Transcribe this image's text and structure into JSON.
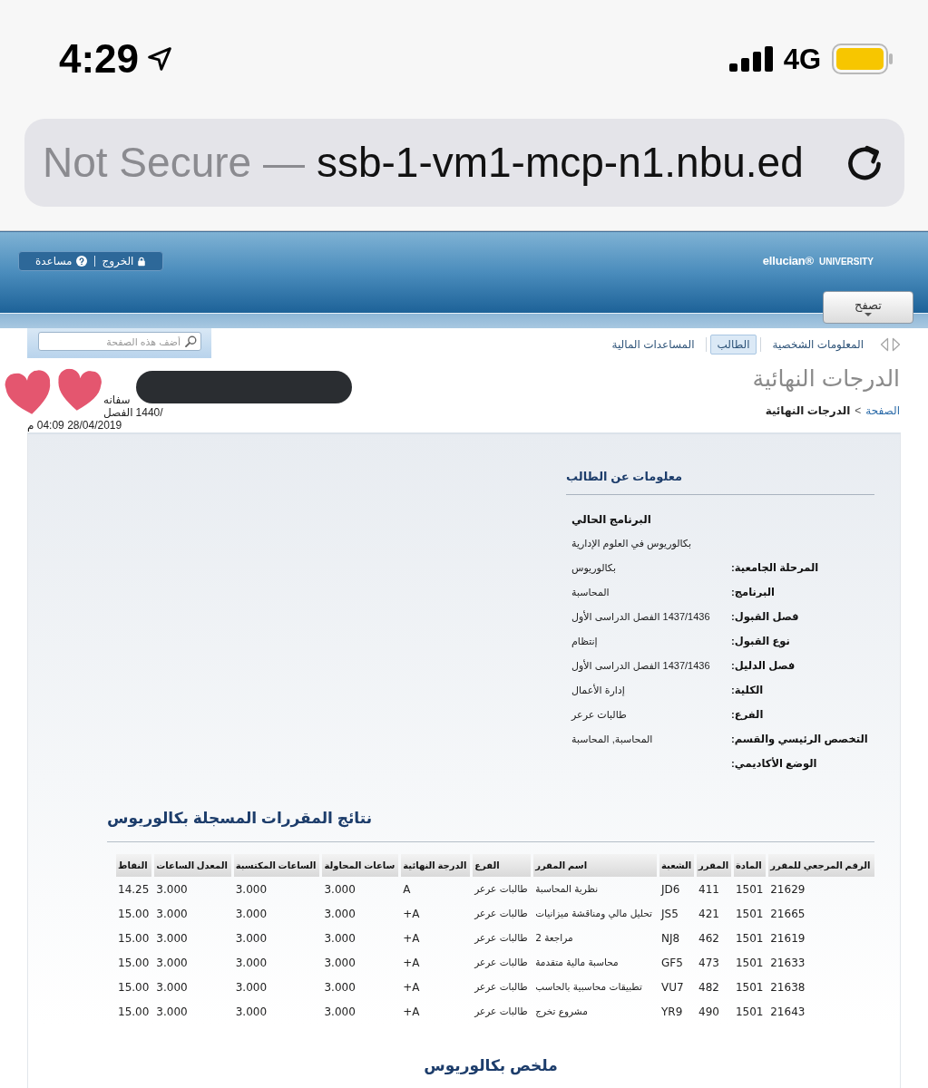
{
  "status_bar": {
    "time": "4:29",
    "network": "4G"
  },
  "address_bar": {
    "security_label": "Not Secure —",
    "url": "ssb-1-vm1-mcp-n1.nbu.ed"
  },
  "header": {
    "top_links": [
      {
        "label": "الخروج",
        "kind": "logout"
      },
      {
        "label": "مساعدة",
        "kind": "help"
      }
    ],
    "brand": "ellucian®",
    "brand_suffix": "UNIVERSITY",
    "browse_button": "تصفح"
  },
  "search": {
    "placeholder": "أضف هذه الصفحة"
  },
  "nav_tabs": [
    {
      "label": "المعلومات الشخصية",
      "selected": false
    },
    {
      "label": "الطالب",
      "selected": true
    },
    {
      "label": "المساعدات المالية",
      "selected": false
    }
  ],
  "student_header_lines": [
    [
      "سفانه"
    ],
    [
      "1440/",
      "الفصل"
    ],
    [
      "28/04/2019 04:09 م"
    ]
  ],
  "page_title": "الدرجات النهائية",
  "breadcrumb": [
    {
      "label": "الصفحة",
      "kind": "link"
    },
    {
      "label": ">",
      "kind": "separator"
    },
    {
      "label": "الدرجات النهائية",
      "kind": "current"
    }
  ],
  "student_info": {
    "title": "معلومات عن الطالب",
    "rows": [
      {
        "kind": "heading",
        "text": "البرنامج الحالي"
      },
      {
        "kind": "value",
        "text": "بكالوريوس في العلوم الإدارية"
      },
      {
        "kind": "field",
        "label": "المرحلة الجامعية:",
        "value": "بكالوريوس"
      },
      {
        "kind": "field",
        "label": "البرنامج:",
        "value": "المحاسبة"
      },
      {
        "kind": "field",
        "label": "فصل القبول:",
        "value": "1437/1436 الفصل الدراسى الأول"
      },
      {
        "kind": "field",
        "label": "نوع القبول:",
        "value": "إنتظام"
      },
      {
        "kind": "field",
        "label": "فصل الدليل:",
        "value": "1437/1436 الفصل الدراسى الأول"
      },
      {
        "kind": "field",
        "label": "الكلية:",
        "value": "إدارة الأعمال"
      },
      {
        "kind": "field",
        "label": "الفرع:",
        "value": "طالبات عرعر"
      },
      {
        "kind": "field",
        "label": "التخصص الرئيسي والقسم:",
        "value": "المحاسبة, المحاسبة"
      },
      {
        "kind": "field",
        "label": "الوضع الأكاديمي:"
      }
    ]
  },
  "courses": {
    "title": "نتائج المقررات المسجلة بكالوريوس",
    "columns": [
      "الرقم المرجعي للمقرر",
      "المادة",
      "المقرر",
      "الشعبة",
      "اسم المقرر",
      "الفرع",
      "الدرجة النهائية",
      "ساعات المحاولة",
      "الساعات المكتسبة",
      "المعدل الساعات",
      "النقاط"
    ],
    "rows": [
      [
        "21629",
        "1501",
        "411",
        "JD6",
        "نظرية المحاسبة",
        "طالبات عرعر",
        "A",
        "3.000",
        "3.000",
        "3.000",
        "14.25"
      ],
      [
        "21665",
        "1501",
        "421",
        "JS5",
        "تحليل مالي ومناقشة ميزانيات",
        "طالبات عرعر",
        "+A",
        "3.000",
        "3.000",
        "3.000",
        "15.00"
      ],
      [
        "21619",
        "1501",
        "462",
        "NJ8",
        "مراجعة 2",
        "طالبات عرعر",
        "+A",
        "3.000",
        "3.000",
        "3.000",
        "15.00"
      ],
      [
        "21633",
        "1501",
        "473",
        "GF5",
        "محاسبة مالية متقدمة",
        "طالبات عرعر",
        "+A",
        "3.000",
        "3.000",
        "3.000",
        "15.00"
      ],
      [
        "21638",
        "1501",
        "482",
        "VU7",
        "تطبيقات محاسبية بالحاسب",
        "طالبات عرعر",
        "+A",
        "3.000",
        "3.000",
        "3.000",
        "15.00"
      ],
      [
        "21643",
        "1501",
        "490",
        "YR9",
        "مشروع تخرج",
        "طالبات عرعر",
        "+A",
        "3.000",
        "3.000",
        "3.000",
        "15.00"
      ]
    ]
  },
  "summary": {
    "title": "ملخص بكالوريوس"
  }
}
